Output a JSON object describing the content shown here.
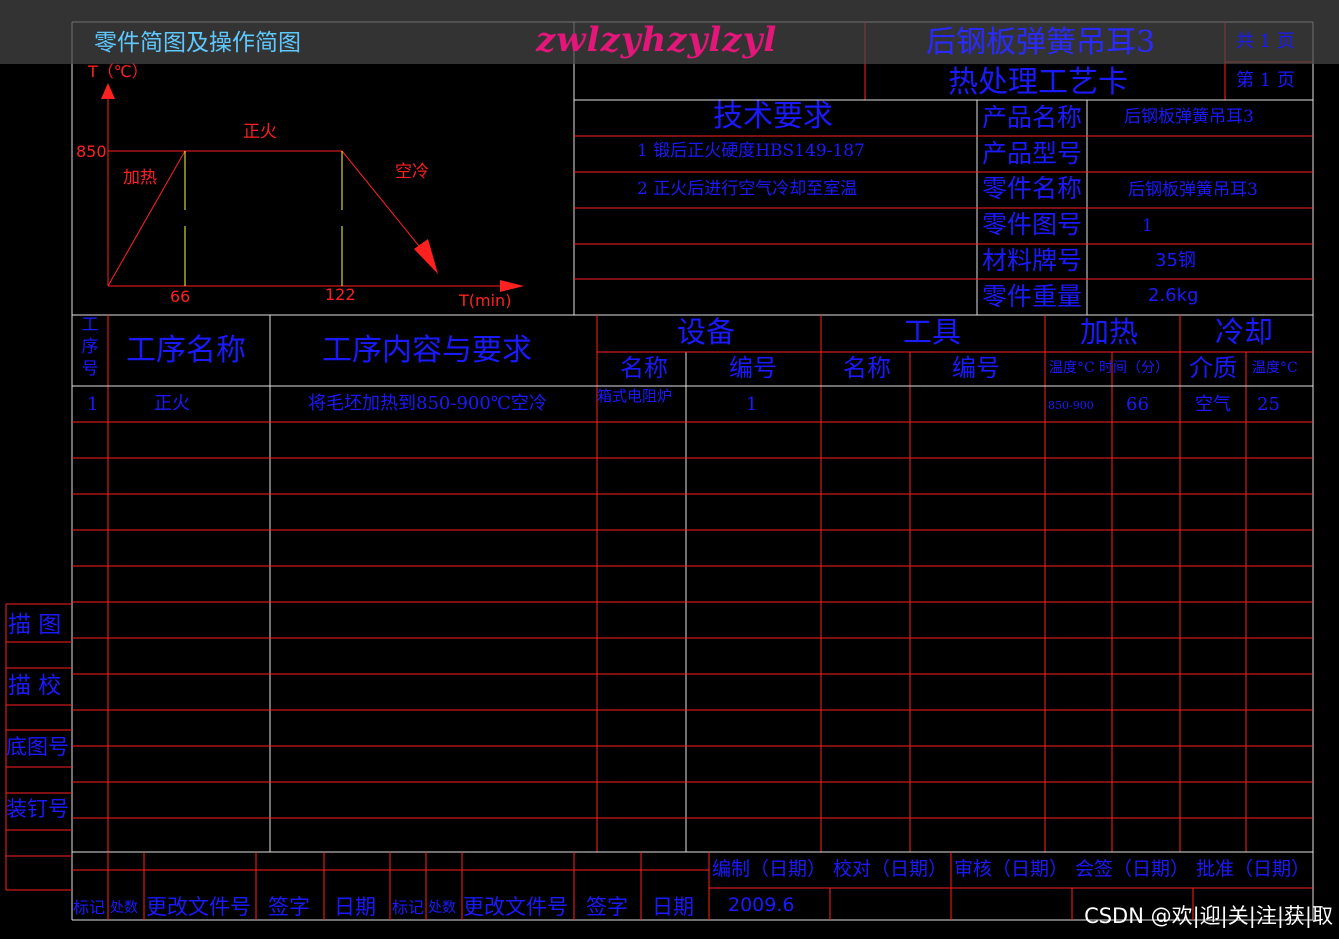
{
  "colors": {
    "border": "#e0e0e0",
    "grid": "#ff2020",
    "text": "#1a1aff",
    "curve": "#ff2020",
    "phase_line": "#ffff33",
    "tab_title": "#5fc8ff"
  },
  "header": {
    "sketch_title": "零件简图及操作简图",
    "watermark": "zwlzyhzylzyl",
    "part_title": "后钢板弹簧吊耳3",
    "card_title": "热处理工艺卡",
    "total_pages": "共 1 页",
    "page_no": "第 1 页"
  },
  "diagram": {
    "y_axis_label": "T（℃）",
    "x_axis_label": "T(min)",
    "temp_label": "850",
    "heating_label": "加热",
    "hold_label": "正火",
    "cooling_label": "空冷",
    "x_tick_1": "66",
    "x_tick_2": "122"
  },
  "tech_requirements": {
    "heading": "技术要求",
    "items": [
      "1  锻后正火硬度HBS149-187",
      "2  正火后进行空气冷却至室温"
    ]
  },
  "product_info": [
    {
      "label": "产品名称",
      "value": "后钢板弹簧吊耳3"
    },
    {
      "label": "产品型号",
      "value": ""
    },
    {
      "label": "零件名称",
      "value": "后钢板弹簧吊耳3"
    },
    {
      "label": "零件图号",
      "value": "1"
    },
    {
      "label": "材料牌号",
      "value": "35钢"
    },
    {
      "label": "零件重量",
      "value": "2.6kg"
    }
  ],
  "table_header": {
    "seq": "工序号",
    "process_name": "工序名称",
    "process_content": "工序内容与要求",
    "equipment": "设备",
    "tools": "工具",
    "heating": "加热",
    "cooling": "冷却",
    "eq_name": "名称",
    "eq_no": "编号",
    "tool_name": "名称",
    "tool_no": "编号",
    "heat_temp": "温度°C",
    "heat_time": "时间（分）",
    "cool_medium": "介质",
    "cool_temp": "温度°C"
  },
  "rows": [
    {
      "seq": "1",
      "name": "正火",
      "content": "将毛坯加热到850-900℃空冷",
      "eq_name": "箱式电阻炉",
      "eq_no": "1",
      "tool_name": "",
      "tool_no": "",
      "heat_temp": "850-900",
      "heat_time": "66",
      "cool_medium": "空气",
      "cool_temp": "25"
    }
  ],
  "side_labels": [
    "描 图",
    "描 校",
    "底图号",
    "装钉号"
  ],
  "footer": {
    "revision_labels": [
      "标记",
      "处数",
      "更改文件号",
      "签字",
      "日期",
      "标记",
      "处数",
      "更改文件号",
      "签字",
      "日期"
    ],
    "signoff_labels": [
      "编制（日期）",
      "校对（日期）",
      "审核（日期）",
      "会签（日期）",
      "批准（日期）"
    ],
    "date_value": "2009.6"
  },
  "csdn_watermark": "CSDN @欢|迎|关|注|获|取"
}
